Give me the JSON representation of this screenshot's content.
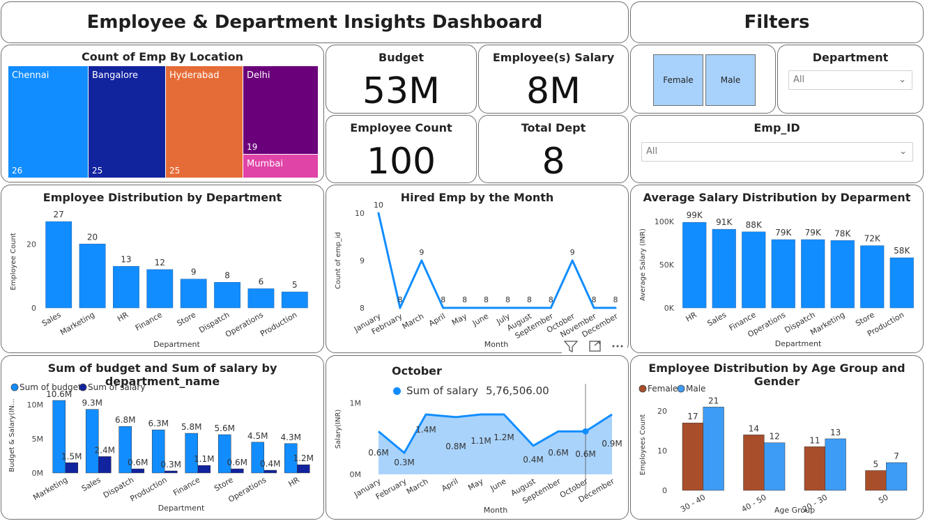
{
  "header": {
    "title": "Employee & Department Insights Dashboard",
    "filters_title": "Filters"
  },
  "treemap": {
    "title": "Count of Emp By Location",
    "cells": [
      {
        "name": "Chennai",
        "count": "26",
        "color": "#118dff"
      },
      {
        "name": "Bangalore",
        "count": "25",
        "color": "#12239e"
      },
      {
        "name": "Hyderabad",
        "count": "25",
        "color": "#e66c37"
      },
      {
        "name": "Delhi",
        "count": "19",
        "color": "#6b007b"
      },
      {
        "name": "Mumbai",
        "count": "",
        "color": "#e044a7"
      }
    ]
  },
  "kpis": {
    "budget": {
      "label": "Budget",
      "value": "53M"
    },
    "salary": {
      "label": "Employee(s) Salary",
      "value": "8M"
    },
    "count": {
      "label": "Employee Count",
      "value": "100"
    },
    "dept": {
      "label": "Total Dept",
      "value": "8"
    }
  },
  "slicers": {
    "gender_options": [
      "Female",
      "Male"
    ],
    "department": {
      "label": "Department",
      "value": "All"
    },
    "emp_id": {
      "label": "Emp_ID",
      "value": "All"
    }
  },
  "tooltip": {
    "title": "October",
    "series": "Sum of salary",
    "value": "5,76,506.00"
  },
  "colors": {
    "primary": "#118dff",
    "dark": "#12239e",
    "brown": "#a94e2b",
    "male": "#3d9cf5",
    "area": "#a9d3fb"
  },
  "chart_data": [
    {
      "id": "emp_by_dept",
      "type": "bar",
      "title": "Employee Distribution by Department",
      "xlabel": "Department",
      "ylabel": "Employee Count",
      "categories": [
        "Sales",
        "Marketing",
        "HR",
        "Finance",
        "Store",
        "Dispatch",
        "Operations",
        "Production"
      ],
      "values": [
        27,
        20,
        13,
        12,
        9,
        8,
        6,
        5
      ],
      "data_labels": [
        "27",
        "20",
        "13",
        "12",
        "9",
        "8",
        "6",
        "5"
      ],
      "yticks": [
        "0",
        "20"
      ],
      "ylim": [
        0,
        29
      ]
    },
    {
      "id": "hired_by_month",
      "type": "line",
      "title": "Hired Emp by the Month",
      "xlabel": "Month",
      "ylabel": "Count of emp_id",
      "categories": [
        "January",
        "February",
        "March",
        "April",
        "May",
        "June",
        "July",
        "August",
        "September",
        "October",
        "November",
        "December"
      ],
      "values": [
        10,
        8,
        9,
        8,
        8,
        8,
        8,
        8,
        8,
        9,
        8,
        8
      ],
      "data_labels": [
        "10",
        "8",
        "9",
        "8",
        "8",
        "8",
        "8",
        "8",
        "8",
        "9",
        "8",
        "8"
      ],
      "yticks": [
        "8",
        "9",
        "10"
      ],
      "ylim": [
        8,
        10
      ]
    },
    {
      "id": "avg_salary_by_dept",
      "type": "bar",
      "title": "Average Salary Distribution by Deparment",
      "xlabel": "Department",
      "ylabel": "Average Salary (INR)",
      "categories": [
        "HR",
        "Sales",
        "Finance",
        "Operations",
        "Dispatch",
        "Marketing",
        "Store",
        "Production"
      ],
      "values": [
        99,
        91,
        88,
        79,
        79,
        78,
        72,
        58
      ],
      "data_labels": [
        "99K",
        "91K",
        "88K",
        "79K",
        "79K",
        "78K",
        "72K",
        "58K"
      ],
      "yticks": [
        "0K",
        "50K",
        "100K"
      ],
      "ylim": [
        0,
        100
      ]
    },
    {
      "id": "budget_salary_by_dept",
      "type": "bar",
      "title": "Sum of budget and Sum of salary by department_name",
      "xlabel": "Department",
      "ylabel": "Budget & Salary(IN...",
      "categories": [
        "Marketing",
        "Sales",
        "Dispatch",
        "Production",
        "Finance",
        "Store",
        "Operations",
        "HR"
      ],
      "series": [
        {
          "name": "Sum of budget",
          "values": [
            10.6,
            9.3,
            6.8,
            6.3,
            5.8,
            5.6,
            4.5,
            4.3
          ],
          "labels": [
            "10.6M",
            "9.3M",
            "6.8M",
            "6.3M",
            "5.8M",
            "5.6M",
            "4.5M",
            "4.3M"
          ]
        },
        {
          "name": "Sum of salary",
          "values": [
            1.5,
            2.4,
            0.6,
            0.3,
            1.1,
            0.6,
            0.4,
            1.2
          ],
          "labels": [
            "1.5M",
            "2.4M",
            "0.6M",
            "0.3M",
            "1.1M",
            "0.6M",
            "0.4M",
            "1.2M"
          ]
        }
      ],
      "yticks": [
        "0M",
        "5M",
        "10M"
      ],
      "ylim": [
        0,
        11
      ]
    },
    {
      "id": "salary_by_month",
      "type": "area",
      "xlabel": "Month",
      "ylabel": "Salary(INR)",
      "categories": [
        "January",
        "February",
        "March",
        "April",
        "May",
        "June",
        "August",
        "September",
        "October",
        "December"
      ],
      "values": [
        0.6,
        0.3,
        1.4,
        0.8,
        1.1,
        1.2,
        0.4,
        0.6,
        0.6,
        0.9
      ],
      "data_labels": [
        "0.6M",
        "0.3M",
        "1.4M",
        "0.8M",
        "1.1M",
        "1.2M",
        "0.4M",
        "0.6M",
        "0.6M",
        "0.9M"
      ],
      "yticks": [
        "0M",
        "1M"
      ],
      "ylim": [
        0,
        1.1
      ]
    },
    {
      "id": "age_gender",
      "type": "bar",
      "title": "Employee Distribution by Age Group and Gender",
      "xlabel": "Age Group",
      "ylabel": "Employees Count",
      "categories": [
        "30 - 40",
        "40 - 50",
        "20 - 30",
        "50"
      ],
      "series": [
        {
          "name": "Female",
          "values": [
            17,
            14,
            11,
            5
          ],
          "labels": [
            "17",
            "14",
            "11",
            "5"
          ]
        },
        {
          "name": "Male",
          "values": [
            21,
            12,
            13,
            7
          ],
          "labels": [
            "21",
            "12",
            "13",
            "7"
          ]
        }
      ],
      "yticks": [
        "0",
        "10",
        "20"
      ],
      "ylim": [
        0,
        23
      ]
    }
  ]
}
